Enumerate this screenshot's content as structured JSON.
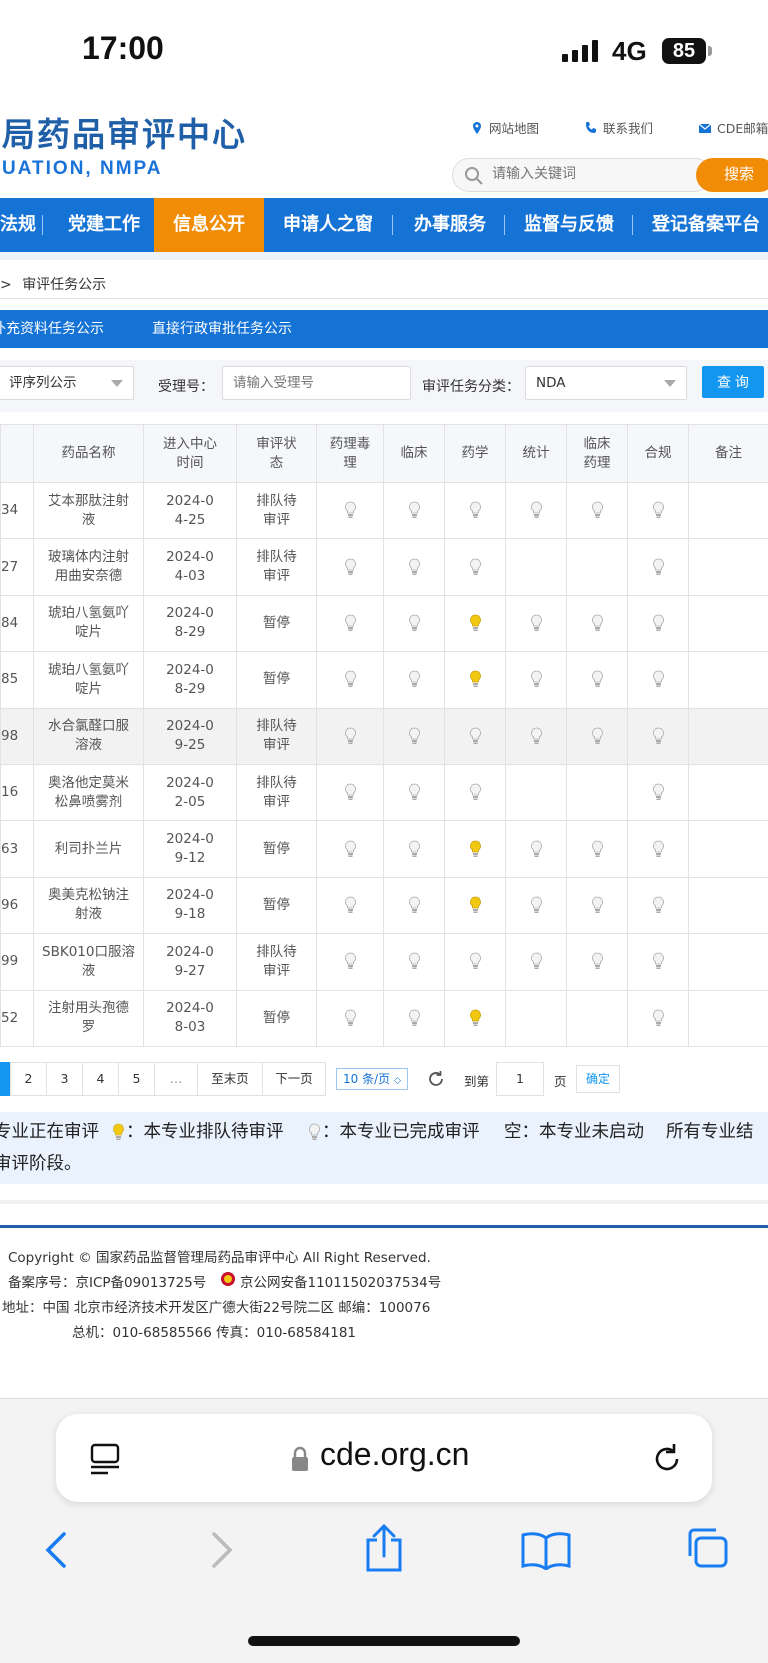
{
  "status_bar": {
    "time": "17:00",
    "network": "4G",
    "battery": "85"
  },
  "header": {
    "title": "局药品审评中心",
    "subtitle": "UATION, NMPA",
    "links": [
      "网站地图",
      "联系我们",
      "CDE邮箱"
    ],
    "search_placeholder": "请输入关键词",
    "search_button": "搜索"
  },
  "nav": {
    "items": [
      "法规",
      "党建工作",
      "信息公开",
      "申请人之窗",
      "办事服务",
      "监督与反馈",
      "登记备案平台"
    ],
    "active": "信息公开"
  },
  "breadcrumb": {
    "sep": ">",
    "current": "审评任务公示"
  },
  "subtabs": [
    "补充资料任务公示",
    "直接行政审批任务公示"
  ],
  "filters": {
    "sequence_value": "评序列公示",
    "accept_label": "受理号：",
    "accept_placeholder": "请输入受理号",
    "category_label": "审评任务分类：",
    "category_value": "NDA",
    "query_button": "查 询"
  },
  "table": {
    "headers": [
      "",
      "药品名称",
      "进入中心\n时间",
      "审评状\n态",
      "药理毒\n理",
      "临床",
      "药学",
      "统计",
      "临床\n药理",
      "合规",
      "备注"
    ],
    "rows": [
      {
        "id": "34",
        "name": "艾本那肽注射液",
        "date": "2024-04-25",
        "status": "排队待审评",
        "bulbs": [
          "o",
          "o",
          "o",
          "o",
          "o",
          "o"
        ]
      },
      {
        "id": "27",
        "name": "玻璃体内注射用曲安奈德",
        "date": "2024-04-03",
        "status": "排队待审评",
        "bulbs": [
          "o",
          "o",
          "o",
          "",
          "",
          "o"
        ]
      },
      {
        "id": "84",
        "name": "琥珀八氢氨吖啶片",
        "date": "2024-08-29",
        "status": "暂停",
        "bulbs": [
          "o",
          "o",
          "y",
          "o",
          "o",
          "o"
        ]
      },
      {
        "id": "85",
        "name": "琥珀八氢氨吖啶片",
        "date": "2024-08-29",
        "status": "暂停",
        "bulbs": [
          "o",
          "o",
          "y",
          "o",
          "o",
          "o"
        ]
      },
      {
        "id": "98",
        "name": "水合氯醛口服溶液",
        "date": "2024-09-25",
        "status": "排队待审评",
        "bulbs": [
          "o",
          "o",
          "o",
          "o",
          "o",
          "o"
        ]
      },
      {
        "id": "16",
        "name": "奥洛他定莫米松鼻喷雾剂",
        "date": "2024-02-05",
        "status": "排队待审评",
        "bulbs": [
          "o",
          "o",
          "o",
          "",
          "",
          "o"
        ]
      },
      {
        "id": "63",
        "name": "利司扑兰片",
        "date": "2024-09-12",
        "status": "暂停",
        "bulbs": [
          "o",
          "o",
          "y",
          "o",
          "o",
          "o"
        ]
      },
      {
        "id": "96",
        "name": "奥美克松钠注射液",
        "date": "2024-09-18",
        "status": "暂停",
        "bulbs": [
          "o",
          "o",
          "y",
          "o",
          "o",
          "o"
        ]
      },
      {
        "id": "99",
        "name": "SBK010口服溶液",
        "date": "2024-09-27",
        "status": "排队待审评",
        "bulbs": [
          "o",
          "o",
          "o",
          "o",
          "o",
          "o"
        ]
      },
      {
        "id": "52",
        "name": "注射用头孢德罗",
        "date": "2024-08-03",
        "status": "暂停",
        "bulbs": [
          "o",
          "o",
          "y",
          "",
          "",
          "o"
        ]
      }
    ]
  },
  "pager": {
    "pages": [
      "2",
      "3",
      "4",
      "5",
      "…"
    ],
    "last": "至末页",
    "next": "下一页",
    "per_page": "10 条/页",
    "goto_label": "到第",
    "goto_value": "1",
    "page_unit": "页",
    "confirm": "确定"
  },
  "legend": {
    "part1": "专业正在审评",
    "part2": "：本专业排队待审评",
    "part3": "：本专业已完成审评",
    "part4": "空：本专业未启动",
    "part5": "所有专业结",
    "line2": "审评阶段。"
  },
  "footer": {
    "copyright": "Copyright © 国家药品监督管理局药品审评中心   All Right Reserved.",
    "icp": "备案序号：京ICP备09013725号",
    "police": "京公网安备11011502037534号",
    "address": "地址：中国 北京市经济技术开发区广德大街22号院二区      邮编：100076",
    "phone": "总机：010-68585566      传真：010-68584181"
  },
  "browser": {
    "url": "cde.org.cn"
  },
  "colors": {
    "brand_blue": "#1573d6",
    "active_orange": "#f08c06",
    "bulb_yellow": "#f2c811"
  }
}
